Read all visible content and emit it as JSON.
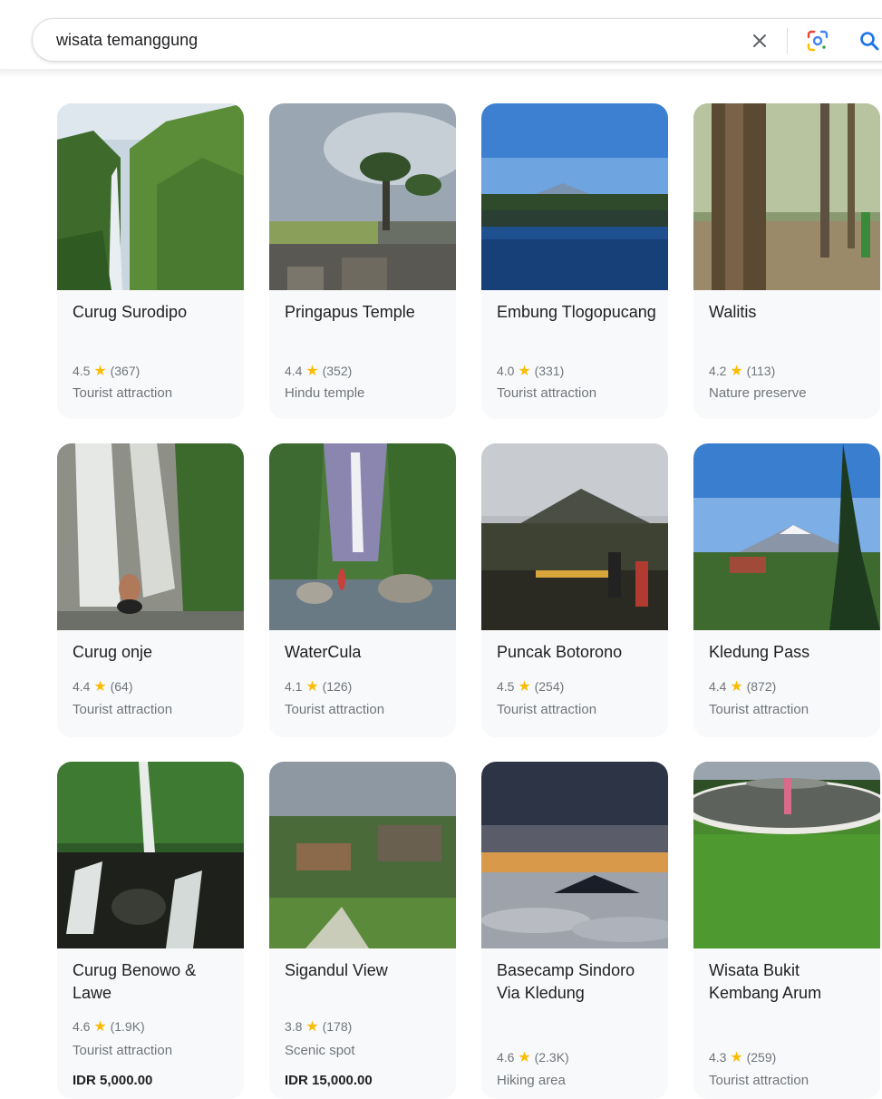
{
  "search": {
    "query": "wisata temanggung",
    "icons": {
      "clear": "close-icon",
      "lens": "google-lens-icon",
      "search": "search-icon"
    }
  },
  "colors": {
    "star": "#fbbc04",
    "search_blue": "#1a73e8",
    "card_bg": "#f8f9fa",
    "meta_text": "#70757a"
  },
  "places": [
    {
      "name": "Curug Surodipo",
      "rating": "4.5",
      "reviews": "(367)",
      "category": "Tourist attraction"
    },
    {
      "name": "Pringapus Temple",
      "rating": "4.4",
      "reviews": "(352)",
      "category": "Hindu temple"
    },
    {
      "name": "Embung Tlogopucang",
      "rating": "4.0",
      "reviews": "(331)",
      "category": "Tourist attraction"
    },
    {
      "name": "Walitis",
      "rating": "4.2",
      "reviews": "(113)",
      "category": "Nature preserve"
    },
    {
      "name": "Curug onje",
      "rating": "4.4",
      "reviews": "(64)",
      "category": "Tourist attraction"
    },
    {
      "name": "WaterCula",
      "rating": "4.1",
      "reviews": "(126)",
      "category": "Tourist attraction"
    },
    {
      "name": "Puncak Botorono",
      "rating": "4.5",
      "reviews": "(254)",
      "category": "Tourist attraction"
    },
    {
      "name": "Kledung Pass",
      "rating": "4.4",
      "reviews": "(872)",
      "category": "Tourist attraction"
    },
    {
      "name": "Curug Benowo & Lawe",
      "rating": "4.6",
      "reviews": "(1.9K)",
      "category": "Tourist attraction",
      "price": "IDR 5,000.00"
    },
    {
      "name": "Sigandul View",
      "rating": "3.8",
      "reviews": "(178)",
      "category": "Scenic spot",
      "price": "IDR 15,000.00"
    },
    {
      "name": "Basecamp Sindoro Via Kledung",
      "rating": "4.6",
      "reviews": "(2.3K)",
      "category": "Hiking area"
    },
    {
      "name": "Wisata Bukit Kembang Arum",
      "rating": "4.3",
      "reviews": "(259)",
      "category": "Tourist attraction"
    }
  ]
}
